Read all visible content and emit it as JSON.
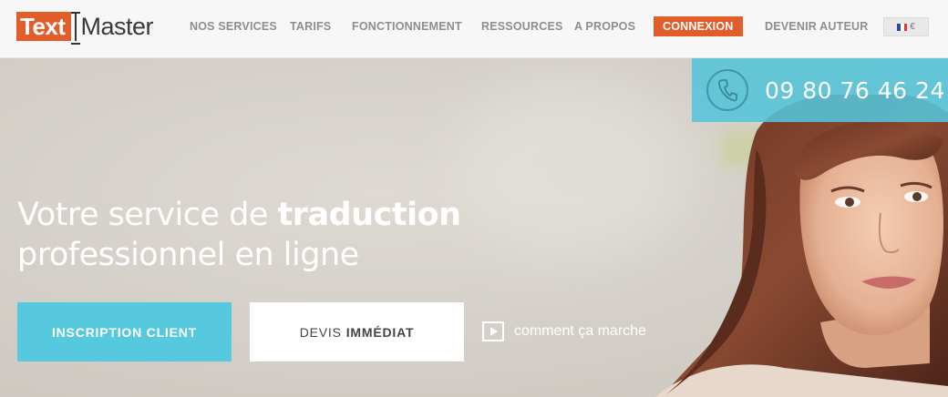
{
  "logo": {
    "part1": "Text",
    "part2": "Master"
  },
  "nav": {
    "services": "NOS SERVICES",
    "tarifs": "TARIFS",
    "fonctionnement": "FONCTIONNEMENT",
    "ressources": "RESSOURCES",
    "apropos": "A PROPOS",
    "connexion": "CONNEXION",
    "devenir": "DEVENIR AUTEUR"
  },
  "lang": {
    "currency": "€",
    "flag_icon": "france-flag-icon"
  },
  "hero": {
    "phone": "09 80 76 46 24",
    "phone_icon": "phone-icon",
    "headline_part1": "Votre service de ",
    "headline_bold": "traduction",
    "headline_line2": "professionnel en ligne",
    "btn_client": "INSCRIPTION CLIENT",
    "btn_devis_a": "DEVIS",
    "btn_devis_b": "IMMÉDIAT",
    "how_label": "comment ça marche",
    "play_icon": "play-icon"
  },
  "colors": {
    "brand": "#e35d2b",
    "accent": "#56c9df"
  }
}
